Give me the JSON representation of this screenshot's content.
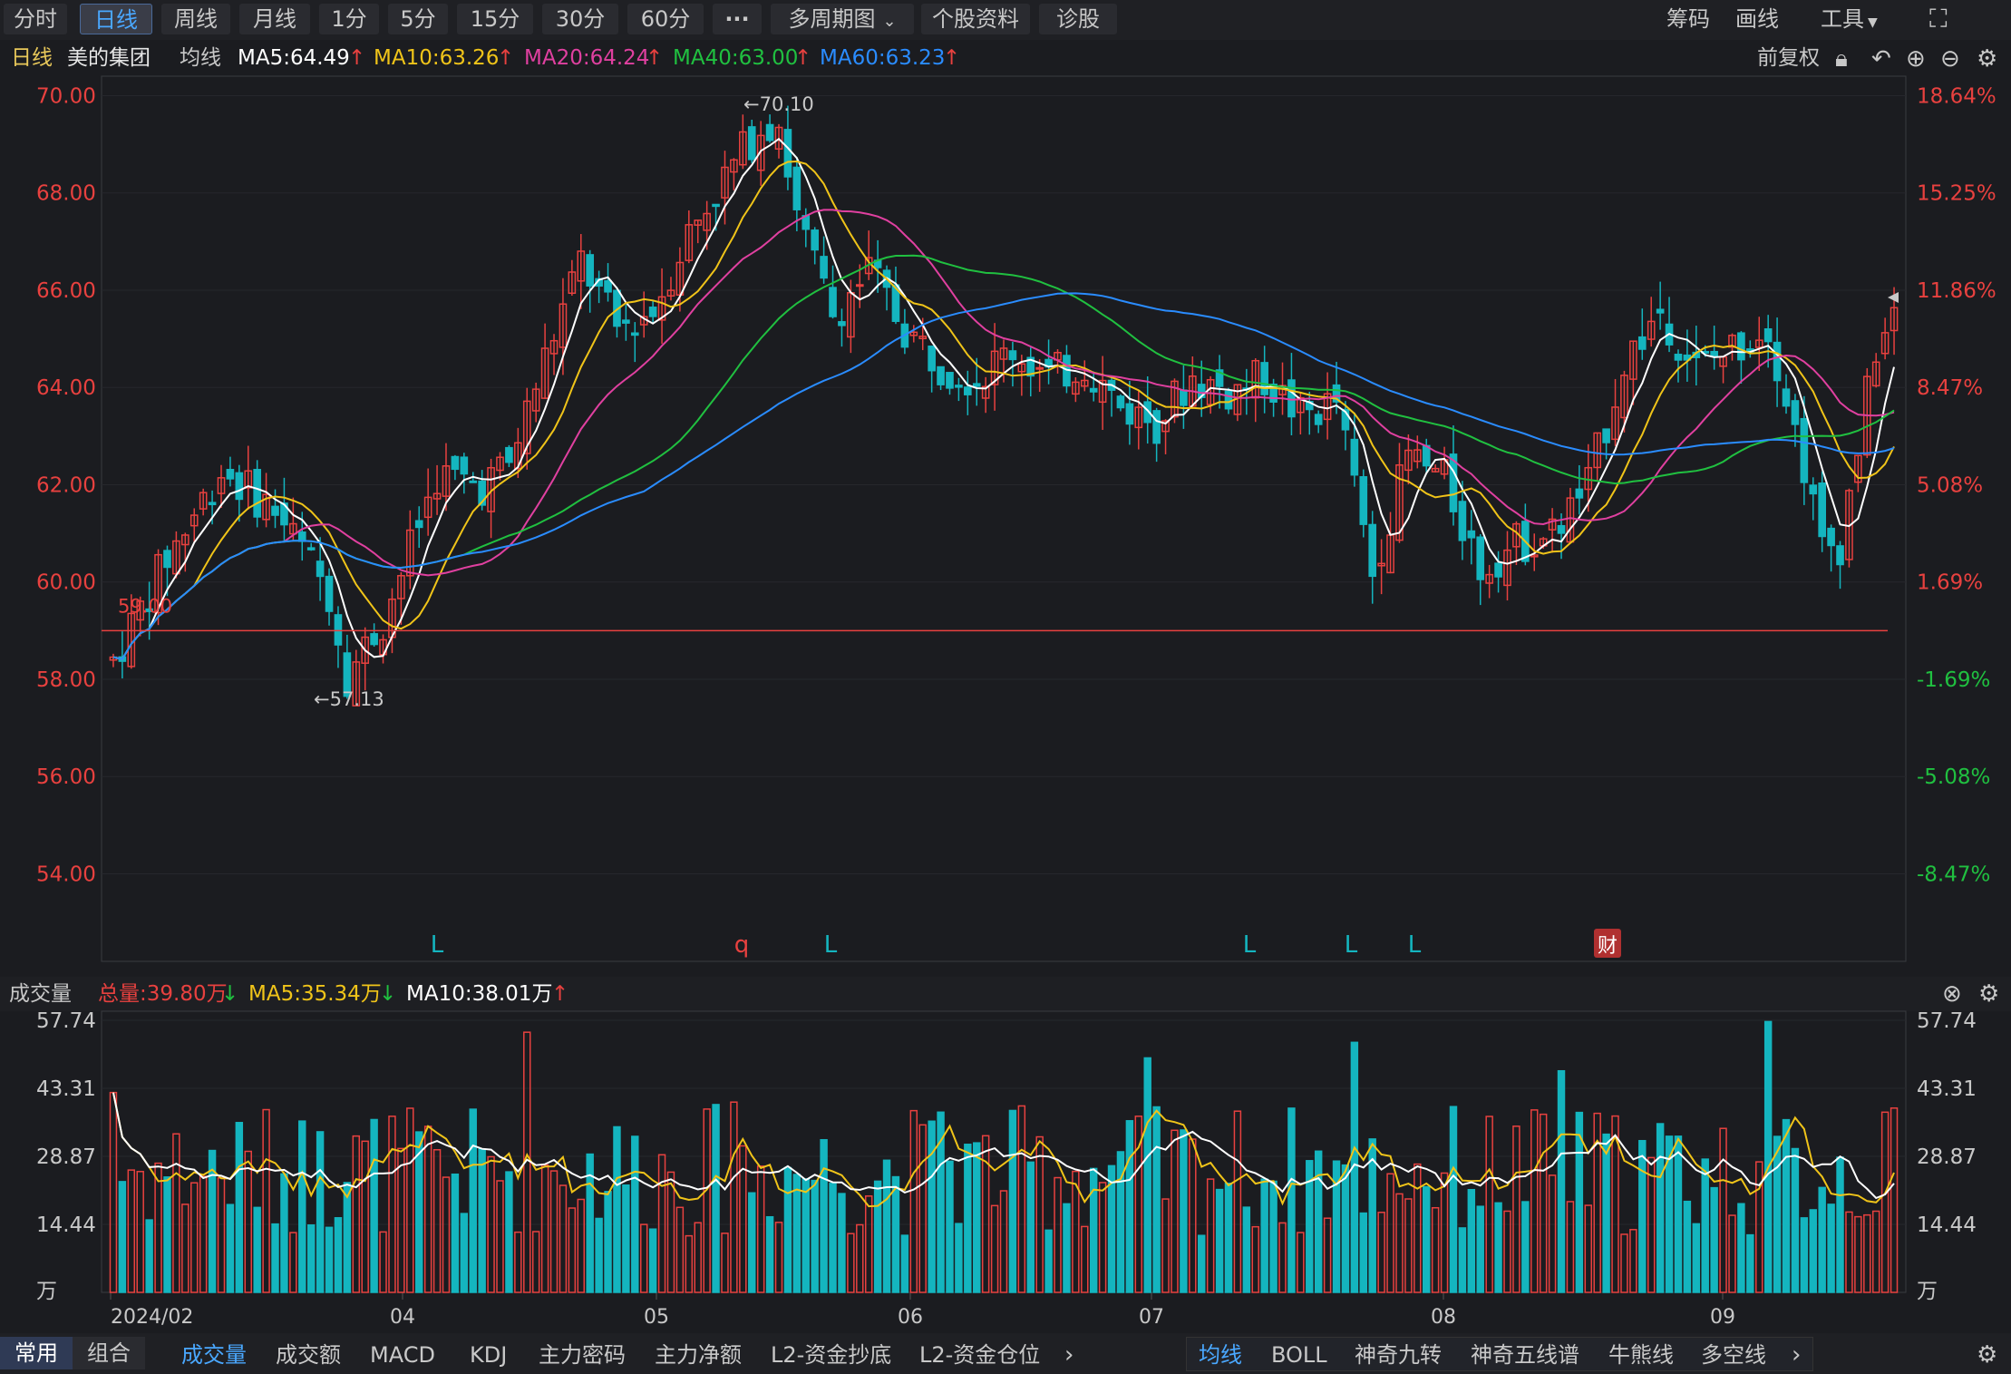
{
  "toolbar": {
    "tabs": [
      "分时",
      "日线",
      "周线",
      "月线",
      "1分",
      "5分",
      "15分",
      "30分",
      "60分",
      "···",
      "多周期图",
      "个股资料",
      "诊股"
    ],
    "active": "日线",
    "right": [
      "筹码",
      "画线",
      "工具"
    ]
  },
  "info": {
    "period": "日线",
    "stock": "美的集团",
    "ma_label": "均线",
    "ma": [
      {
        "text": "MA5:64.49",
        "color": "#ffffff"
      },
      {
        "text": "MA10:63.26",
        "color": "#f0c419"
      },
      {
        "text": "MA20:64.24",
        "color": "#e040a0"
      },
      {
        "text": "MA40:63.00",
        "color": "#20c040"
      },
      {
        "text": "MA60:63.23",
        "color": "#2a8cff"
      }
    ],
    "adjust": "前复权"
  },
  "chart_data": {
    "type": "candlestick",
    "title": "美的集团 日线",
    "price_axis": {
      "ticks": [
        "70.00",
        "68.00",
        "66.00",
        "64.00",
        "62.00",
        "60.00",
        "58.00",
        "56.00",
        "54.00"
      ],
      "ymin": 52.2,
      "ymax": 70.4
    },
    "percent_axis": {
      "ticks": [
        "18.64%",
        "15.25%",
        "11.86%",
        "8.47%",
        "5.08%",
        "1.69%",
        "-1.69%",
        "-5.08%",
        "-8.47%"
      ]
    },
    "date_axis": [
      "2024/02",
      "04",
      "05",
      "06",
      "07",
      "08",
      "09"
    ],
    "annotations": {
      "high": "←70.10",
      "low": "←57.13",
      "ref_line": "59.00"
    },
    "markers": [
      "L",
      "q",
      "L",
      "L",
      "L",
      "L",
      "财"
    ],
    "volume": {
      "label": "成交量",
      "total": "总量:39.80万",
      "ma5": "MA5:35.34万",
      "ma10": "MA10:38.01万",
      "ticks": [
        "57.74",
        "43.31",
        "28.87",
        "14.44",
        "万"
      ]
    }
  },
  "bottom": {
    "left": [
      "常用",
      "组合"
    ],
    "indicators": [
      "成交量",
      "成交额",
      "MACD",
      "KDJ",
      "主力密码",
      "主力净额",
      "L2-资金抄底",
      "L2-资金仓位"
    ],
    "overlays": [
      "均线",
      "BOLL",
      "神奇九转",
      "神奇五线谱",
      "牛熊线",
      "多空线"
    ]
  },
  "colors": {
    "up": "#e8413f",
    "down": "#14b5bf",
    "bg": "#1b1c20"
  }
}
